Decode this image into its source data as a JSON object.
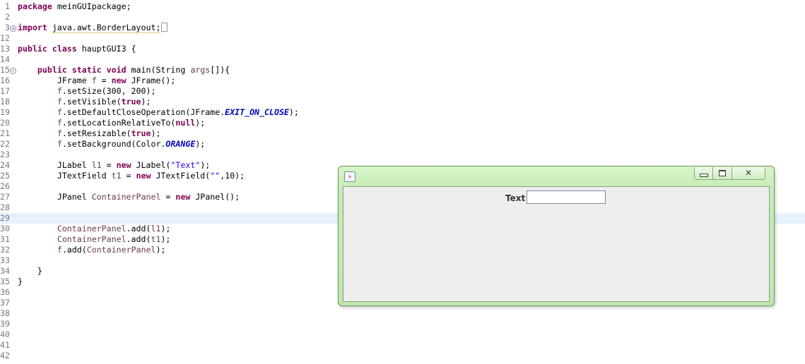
{
  "editor": {
    "lines": [
      {
        "n": "1",
        "code": [
          {
            "k": "kw",
            "t": "package"
          },
          {
            "t": " meinGUIpackage;"
          }
        ]
      },
      {
        "n": "2",
        "code": []
      },
      {
        "n": "3",
        "fold": "+",
        "code": [
          {
            "k": "kw",
            "t": "import"
          },
          {
            "t": " "
          },
          {
            "k": "imp",
            "t": "java.awt.BorderLayout;"
          },
          {
            "k": "box",
            "t": ""
          }
        ]
      },
      {
        "n": "12",
        "code": []
      },
      {
        "n": "13",
        "code": [
          {
            "k": "kw",
            "t": "public class"
          },
          {
            "t": " hauptGUI3 {"
          }
        ]
      },
      {
        "n": "14",
        "code": []
      },
      {
        "n": "15",
        "fold": "-",
        "code": [
          {
            "t": "    "
          },
          {
            "k": "kw",
            "t": "public static void"
          },
          {
            "t": " main(String "
          },
          {
            "k": "var",
            "t": "args"
          },
          {
            "t": "[]){"
          }
        ]
      },
      {
        "n": "16",
        "code": [
          {
            "t": "        JFrame "
          },
          {
            "k": "var",
            "t": "f"
          },
          {
            "t": " = "
          },
          {
            "k": "kw",
            "t": "new"
          },
          {
            "t": " JFrame();"
          }
        ]
      },
      {
        "n": "17",
        "code": [
          {
            "t": "        "
          },
          {
            "k": "var",
            "t": "f"
          },
          {
            "t": ".setSize(300, 200);"
          }
        ]
      },
      {
        "n": "18",
        "code": [
          {
            "t": "        "
          },
          {
            "k": "var",
            "t": "f"
          },
          {
            "t": ".setVisible("
          },
          {
            "k": "kw",
            "t": "true"
          },
          {
            "t": ");"
          }
        ]
      },
      {
        "n": "19",
        "code": [
          {
            "t": "        "
          },
          {
            "k": "var",
            "t": "f"
          },
          {
            "t": ".setDefaultCloseOperation(JFrame."
          },
          {
            "k": "fld",
            "t": "EXIT_ON_CLOSE"
          },
          {
            "t": ");"
          }
        ]
      },
      {
        "n": "20",
        "code": [
          {
            "t": "        "
          },
          {
            "k": "var",
            "t": "f"
          },
          {
            "t": ".setLocationRelativeTo("
          },
          {
            "k": "kw",
            "t": "null"
          },
          {
            "t": ");"
          }
        ]
      },
      {
        "n": "21",
        "code": [
          {
            "t": "        "
          },
          {
            "k": "var",
            "t": "f"
          },
          {
            "t": ".setResizable("
          },
          {
            "k": "kw",
            "t": "true"
          },
          {
            "t": ");"
          }
        ]
      },
      {
        "n": "22",
        "code": [
          {
            "t": "        "
          },
          {
            "k": "var",
            "t": "f"
          },
          {
            "t": ".setBackground(Color."
          },
          {
            "k": "fld",
            "t": "ORANGE"
          },
          {
            "t": ");"
          }
        ]
      },
      {
        "n": "23",
        "code": []
      },
      {
        "n": "24",
        "code": [
          {
            "t": "        JLabel "
          },
          {
            "k": "var",
            "t": "l1"
          },
          {
            "t": " = "
          },
          {
            "k": "kw",
            "t": "new"
          },
          {
            "t": " JLabel("
          },
          {
            "k": "str",
            "t": "\"Text\""
          },
          {
            "t": ");"
          }
        ]
      },
      {
        "n": "25",
        "code": [
          {
            "t": "        JTextField "
          },
          {
            "k": "var",
            "t": "t1"
          },
          {
            "t": " = "
          },
          {
            "k": "kw",
            "t": "new"
          },
          {
            "t": " JTextField("
          },
          {
            "k": "str",
            "t": "\"\""
          },
          {
            "t": ",10);"
          }
        ]
      },
      {
        "n": "26",
        "code": []
      },
      {
        "n": "27",
        "code": [
          {
            "t": "        JPanel "
          },
          {
            "k": "var",
            "t": "ContainerPanel"
          },
          {
            "t": " = "
          },
          {
            "k": "kw",
            "t": "new"
          },
          {
            "t": " JPanel();"
          }
        ]
      },
      {
        "n": "28",
        "code": []
      },
      {
        "n": "29",
        "current": true,
        "code": []
      },
      {
        "n": "30",
        "code": [
          {
            "t": "        "
          },
          {
            "k": "var",
            "t": "ContainerPanel"
          },
          {
            "t": ".add("
          },
          {
            "k": "var",
            "t": "l1"
          },
          {
            "t": ");"
          }
        ]
      },
      {
        "n": "31",
        "code": [
          {
            "t": "        "
          },
          {
            "k": "var",
            "t": "ContainerPanel"
          },
          {
            "t": ".add("
          },
          {
            "k": "var",
            "t": "t1"
          },
          {
            "t": ");"
          }
        ]
      },
      {
        "n": "32",
        "code": [
          {
            "t": "        "
          },
          {
            "k": "var",
            "t": "f"
          },
          {
            "t": ".add("
          },
          {
            "k": "var",
            "t": "ContainerPanel"
          },
          {
            "t": ");"
          }
        ]
      },
      {
        "n": "33",
        "code": []
      },
      {
        "n": "34",
        "code": [
          {
            "t": "    }"
          }
        ]
      },
      {
        "n": "35",
        "code": [
          {
            "t": "}"
          }
        ]
      },
      {
        "n": "36",
        "code": []
      },
      {
        "n": "37",
        "code": []
      },
      {
        "n": "38",
        "code": []
      },
      {
        "n": "39",
        "code": []
      },
      {
        "n": "40",
        "code": []
      },
      {
        "n": "41",
        "code": []
      },
      {
        "n": "42",
        "code": []
      }
    ]
  },
  "window": {
    "icon": "java-cup-icon",
    "label_text": "Text",
    "textfield_value": "",
    "buttons": {
      "minimize": "minimize-icon",
      "maximize": "maximize-icon",
      "close": "close-icon",
      "close_glyph": "✕"
    }
  },
  "colors": {
    "keyword": "#7f0055",
    "string": "#2a00ff",
    "field": "#0000c0",
    "variable": "#6a3e3e",
    "window_frame": "#c4ecb4"
  }
}
